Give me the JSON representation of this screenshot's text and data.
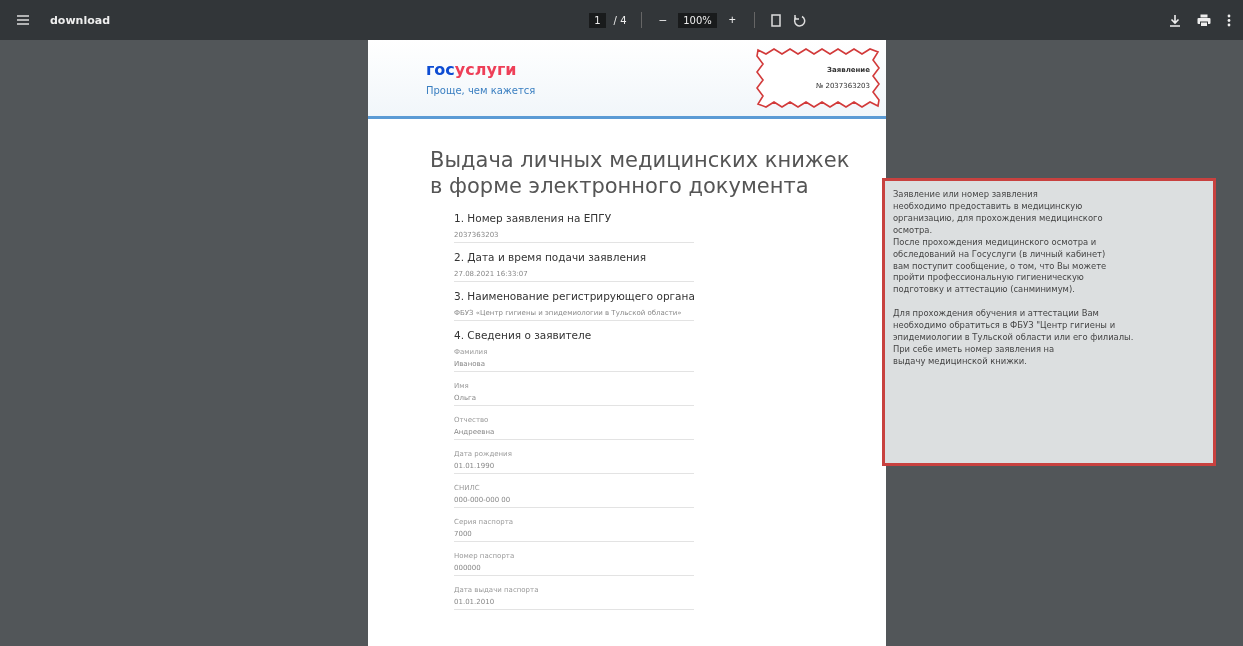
{
  "toolbar": {
    "file_name": "download",
    "page_current": "1",
    "page_total": "/ 4",
    "zoom_out": "–",
    "zoom": "100%",
    "zoom_in": "+"
  },
  "document": {
    "logo_first": "гос",
    "logo_second": "услуги",
    "tagline": "Проще, чем кажется",
    "stamp": {
      "title": "Заявление",
      "number": "№ 2037363203"
    },
    "title": "Выдача личных медицинских книжек в форме электронного документа",
    "sections": [
      {
        "heading": "1. Номер заявления на ЕПГУ",
        "fields": [
          {
            "value": "2037363203"
          }
        ]
      },
      {
        "heading": "2. Дата и время подачи заявления",
        "fields": [
          {
            "value": "27.08.2021 16:33:07"
          }
        ]
      },
      {
        "heading": "3. Наименование регистрирующего органа",
        "fields": [
          {
            "value": "ФБУЗ «Центр гигиены и эпидемиологии в Тульской области»"
          }
        ]
      },
      {
        "heading": "4. Сведения о заявителе",
        "fields": [
          {
            "label": "Фамилия",
            "value": "Иванова"
          },
          {
            "label": "Имя",
            "value": "Ольга"
          },
          {
            "label": "Отчество",
            "value": "Андреевна"
          },
          {
            "label": "Дата рождения",
            "value": "01.01.1990"
          },
          {
            "label": "СНИЛС",
            "value": "000-000-000 00"
          },
          {
            "label": "Серия паспорта",
            "value": "7000"
          },
          {
            "label": "Номер паспорта",
            "value": "000000"
          },
          {
            "label": "Дата выдачи паспорта",
            "value": "01.01.2010"
          }
        ]
      }
    ]
  },
  "note": {
    "paragraphs": [
      "Заявление или номер заявления\nнеобходимо предоставить в медицинскую\nорганизацию, для прохождения медицинского\nосмотра.\nПосле прохождения медицинского осмотра и\nобследований на Госуслуги (в личный кабинет)\nвам поступит сообщение, о том, что Вы можете\nпройти профессиональную гигиеническую\nподготовку и аттестацию (санминимум).",
      "Для прохождения обучения и аттестации Вам\nнеобходимо обратиться в ФБУЗ \"Центр гигиены и\n эпидемиологии в Тульской области или его филиалы.\n При себе иметь номер заявления на\nвыдачу медицинской книжки."
    ]
  }
}
